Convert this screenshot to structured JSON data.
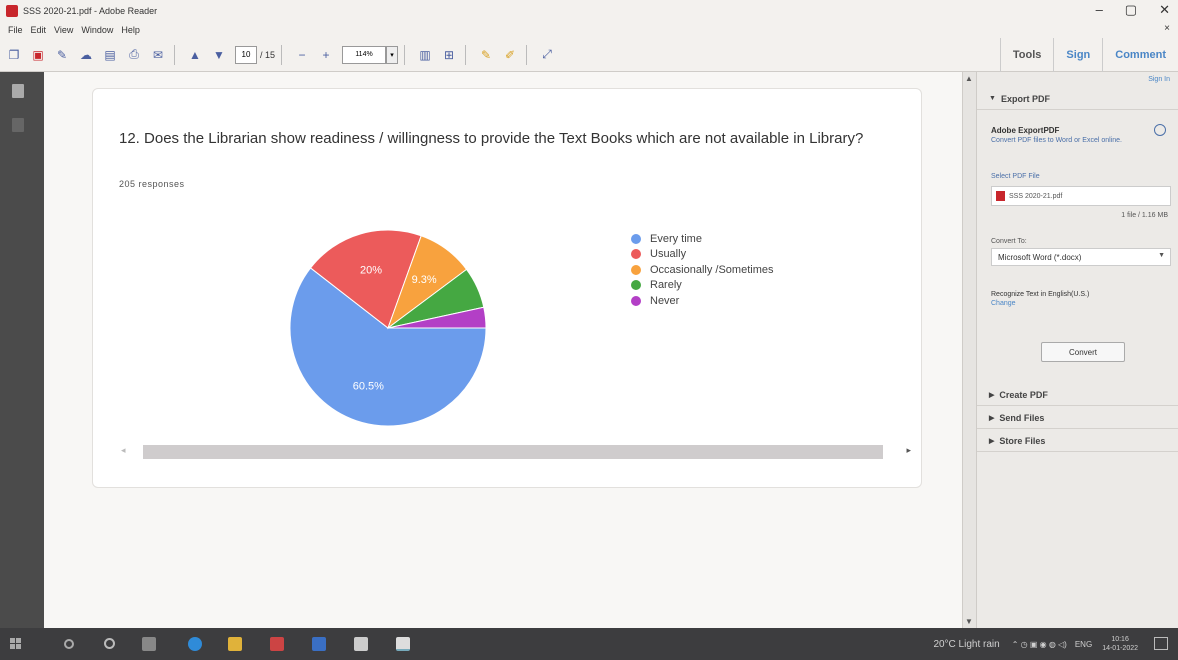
{
  "window": {
    "title": "SSS 2020-21.pdf - Adobe Reader",
    "minimize": "–",
    "maximize": "▢",
    "close": "✕"
  },
  "menu": {
    "items": [
      "File",
      "Edit",
      "View",
      "Window",
      "Help"
    ],
    "close": "×"
  },
  "toolbar": {
    "page_current": "10",
    "page_total": "/ 15",
    "zoom": "114%",
    "tools_label": "Tools",
    "sign_label": "Sign",
    "comment_label": "Comment"
  },
  "form": {
    "question": "12. Does the Librarian show readiness / willingness to provide the Text Books which are not available in Library?",
    "responses": "205 responses"
  },
  "chart_data": {
    "type": "pie",
    "categories": [
      "Every time",
      "Usually",
      "Occasionally /Sometimes",
      "Rarely",
      "Never"
    ],
    "values": [
      60.5,
      20,
      9.3,
      6.8,
      3.4
    ],
    "labels": [
      "60.5%",
      "20%",
      "9.3%",
      "",
      ""
    ],
    "colors": [
      "#6b9cec",
      "#ec5b5b",
      "#f8a23e",
      "#45a842",
      "#b33fc6"
    ]
  },
  "right_pane": {
    "sign_in": "Sign In",
    "export_pdf": "Export PDF",
    "export_title": "Adobe ExportPDF",
    "export_desc": "Convert PDF files to Word or Excel online.",
    "select_label": "Select PDF File",
    "file_name": "SSS 2020-21.pdf",
    "file_size": "1 file / 1.16 MB",
    "convert_to_label": "Convert To:",
    "convert_to_value": "Microsoft Word (*.docx)",
    "recognize": "Recognize Text in English(U.S.)",
    "change": "Change",
    "convert_button": "Convert",
    "create_pdf": "Create PDF",
    "send_files": "Send Files",
    "store_files": "Store Files"
  },
  "taskbar": {
    "weather": "20°C  Light rain",
    "lang": "ENG",
    "time": "10:16",
    "date": "14-01-2022"
  }
}
